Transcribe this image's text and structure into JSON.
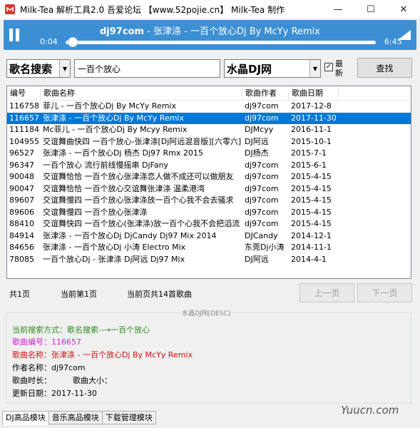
{
  "window": {
    "title": "Milk-Tea 解析工具2.0    吾爱论坛 【www.52pojie.cn】 Milk-Tea 制作",
    "minimize": "—",
    "maximize": "☐",
    "close": "✕"
  },
  "player": {
    "artist": "dj97com",
    "track": " - 张津涤 - 一百个放心Dj By McYy Remix",
    "current_time": "0:04",
    "total_time": "6:45",
    "progress_fraction": 0.01,
    "accent_color": "#3c8fd3"
  },
  "search": {
    "mode_selected": "歌名搜索",
    "query": "一百个放心",
    "source_selected": "水晶DJ网",
    "newest_label": "最新",
    "newest_checked": true,
    "search_button": "查找"
  },
  "table": {
    "headers": [
      "编号",
      "歌曲名称",
      "歌曲作者",
      "歌曲日期",
      ""
    ],
    "selected_index": 1,
    "rows": [
      {
        "id": "116758",
        "name": "菲儿 - 一百个放心Dj By McYy Remix",
        "author": "dj97com",
        "date": "2017-12-8"
      },
      {
        "id": "116657",
        "name": "张津涤 - 一百个放心Dj By McYy Remix",
        "author": "dj97com",
        "date": "2017-11-30"
      },
      {
        "id": "111184",
        "name": "Mc菲儿 - 一百个放心Dj By Mcyy Remix",
        "author": "DJMcyy",
        "date": "2016-11-1"
      },
      {
        "id": "104955",
        "name": "交谊舞曲快四 一百个放心-张津涤[Dj阿远混音版][六零六]",
        "author": "DJ阿远",
        "date": "2015-10-1"
      },
      {
        "id": "96527",
        "name": "张津涤 - 一百个放心Dj 杨杰 Dj97 Rmx 2015",
        "author": "DJ杨杰",
        "date": "2015-7-1"
      },
      {
        "id": "96347",
        "name": "一百个放心 流行前线慢摇串 DjFany",
        "author": "dj97com",
        "date": "2015-6-1"
      },
      {
        "id": "90048",
        "name": "交谊舞恰恰 一百个放心张津涤恋人做不成还可以做朋友",
        "author": "dj97com",
        "date": "2015-4-15"
      },
      {
        "id": "90047",
        "name": "交谊舞恰恰 一百个放心交谊舞张津涤 温柔港湾",
        "author": "dj97com",
        "date": "2015-4-15"
      },
      {
        "id": "89607",
        "name": "交谊舞慢四 一百个放心张津涤放一百个心我不会去骚求",
        "author": "dj97com",
        "date": "2015-4-15"
      },
      {
        "id": "89606",
        "name": "交谊舞慢四 一百个放心张津涤",
        "author": "dj97com",
        "date": "2015-4-15"
      },
      {
        "id": "88410",
        "name": "交谊舞快四 一百个放心(张津涤)放一百个心我不会把滔流",
        "author": "dj97com",
        "date": "2015-4-15"
      },
      {
        "id": "84914",
        "name": "张津涤 - 一百个放心Dj DjCandy Dj97 Mix 2014",
        "author": "DJCandy",
        "date": "2014-12-1"
      },
      {
        "id": "84656",
        "name": "张津涤 - 一百个放心Dj 小涛 Electro Mix",
        "author": "东莞Dj小涛",
        "date": "2014-11-1"
      },
      {
        "id": "78085",
        "name": "一百个放心Dj - 张津涤 Dj阿远 Dj97 Mix",
        "author": "DJ阿远",
        "date": "2014-4-1"
      }
    ]
  },
  "pagination": {
    "total_pages": "共1页",
    "current_page": "当前第1页",
    "page_count": "当前页共14首歌曲",
    "prev_button": "上一页",
    "next_button": "下一页"
  },
  "info": {
    "group_title": "水晶DJ网[DESC]",
    "search_mode": "当前搜索方式：歌名搜索--→一百个放心",
    "song_id": "歌曲编号：116657",
    "song_name": "歌曲名称：张津涤 - 一百个放心Dj By McYy Remix",
    "author": "作者名称：dj97com",
    "duration": "歌曲时长：",
    "size": "歌曲大小：",
    "update_date": "更新日期：2017-11-30",
    "color_search_mode": "#2e8b1e",
    "color_song_id": "#d020d0",
    "color_song_name": "#d01010"
  },
  "tabs": [
    "DJ高品模块",
    "音乐高品模块",
    "下载管理模块"
  ],
  "watermark": "Yuucn.com"
}
